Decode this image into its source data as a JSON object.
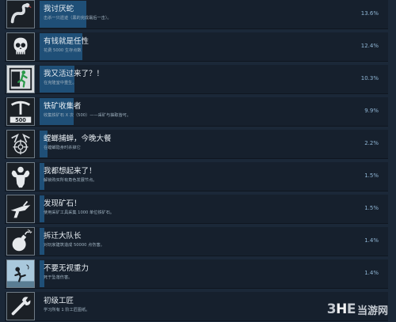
{
  "achievements": [
    {
      "icon": "snake-icon",
      "title": "我讨厌蛇",
      "desc": "击杀一只遗迹（黑的完成最后一击）。",
      "percent": "13.6%",
      "progress": 13.6
    },
    {
      "icon": "skull-icon",
      "title": "有钱就是任性",
      "desc": "花费 5000 生存点数",
      "percent": "12.4%",
      "progress": 12.4
    },
    {
      "icon": "running-exit-icon",
      "title": "我又活过来了？！",
      "desc": "在克隆室中重生。",
      "percent": "10.3%",
      "progress": 10.3
    },
    {
      "icon": "pickaxe-500-icon",
      "title": "铁矿收集者",
      "desc": "收集铁矿石 X 次（500）——采矿与抽取皆可。",
      "percent": "9.9%",
      "progress": 9.9
    },
    {
      "icon": "mantis-target-icon",
      "title": "螳螂捕蝉，今晚大餐",
      "desc": "在螳螂隐身时杀掉它",
      "percent": "2.2%",
      "progress": 2.2
    },
    {
      "icon": "muscle-man-icon",
      "title": "我都想起来了！",
      "desc": "解锁购买所有角色发展节点。",
      "percent": "1.5%",
      "progress": 1.5
    },
    {
      "icon": "drill-icon",
      "title": "发现矿石！",
      "desc": "使用采矿工具采集 1000 单位铁矿石。",
      "percent": "1.5%",
      "progress": 1.5
    },
    {
      "icon": "bomb-icon",
      "title": "拆迁大队长",
      "desc": "对玩家建筑造成 50000 点伤害。",
      "percent": "1.4%",
      "progress": 1.4
    },
    {
      "icon": "falling-man-icon",
      "title": "不要无视重力",
      "desc": "死于坠落伤害。",
      "percent": "1.4%",
      "progress": 1.4
    },
    {
      "icon": "wrench-icon",
      "title": "初级工匠",
      "desc": "学习所有 1 阶工匠图纸。",
      "percent": "",
      "progress": 0
    }
  ],
  "watermark": {
    "logo_a": "3",
    "logo_b": "H",
    "logo_c": "E",
    "site": "当游网"
  }
}
